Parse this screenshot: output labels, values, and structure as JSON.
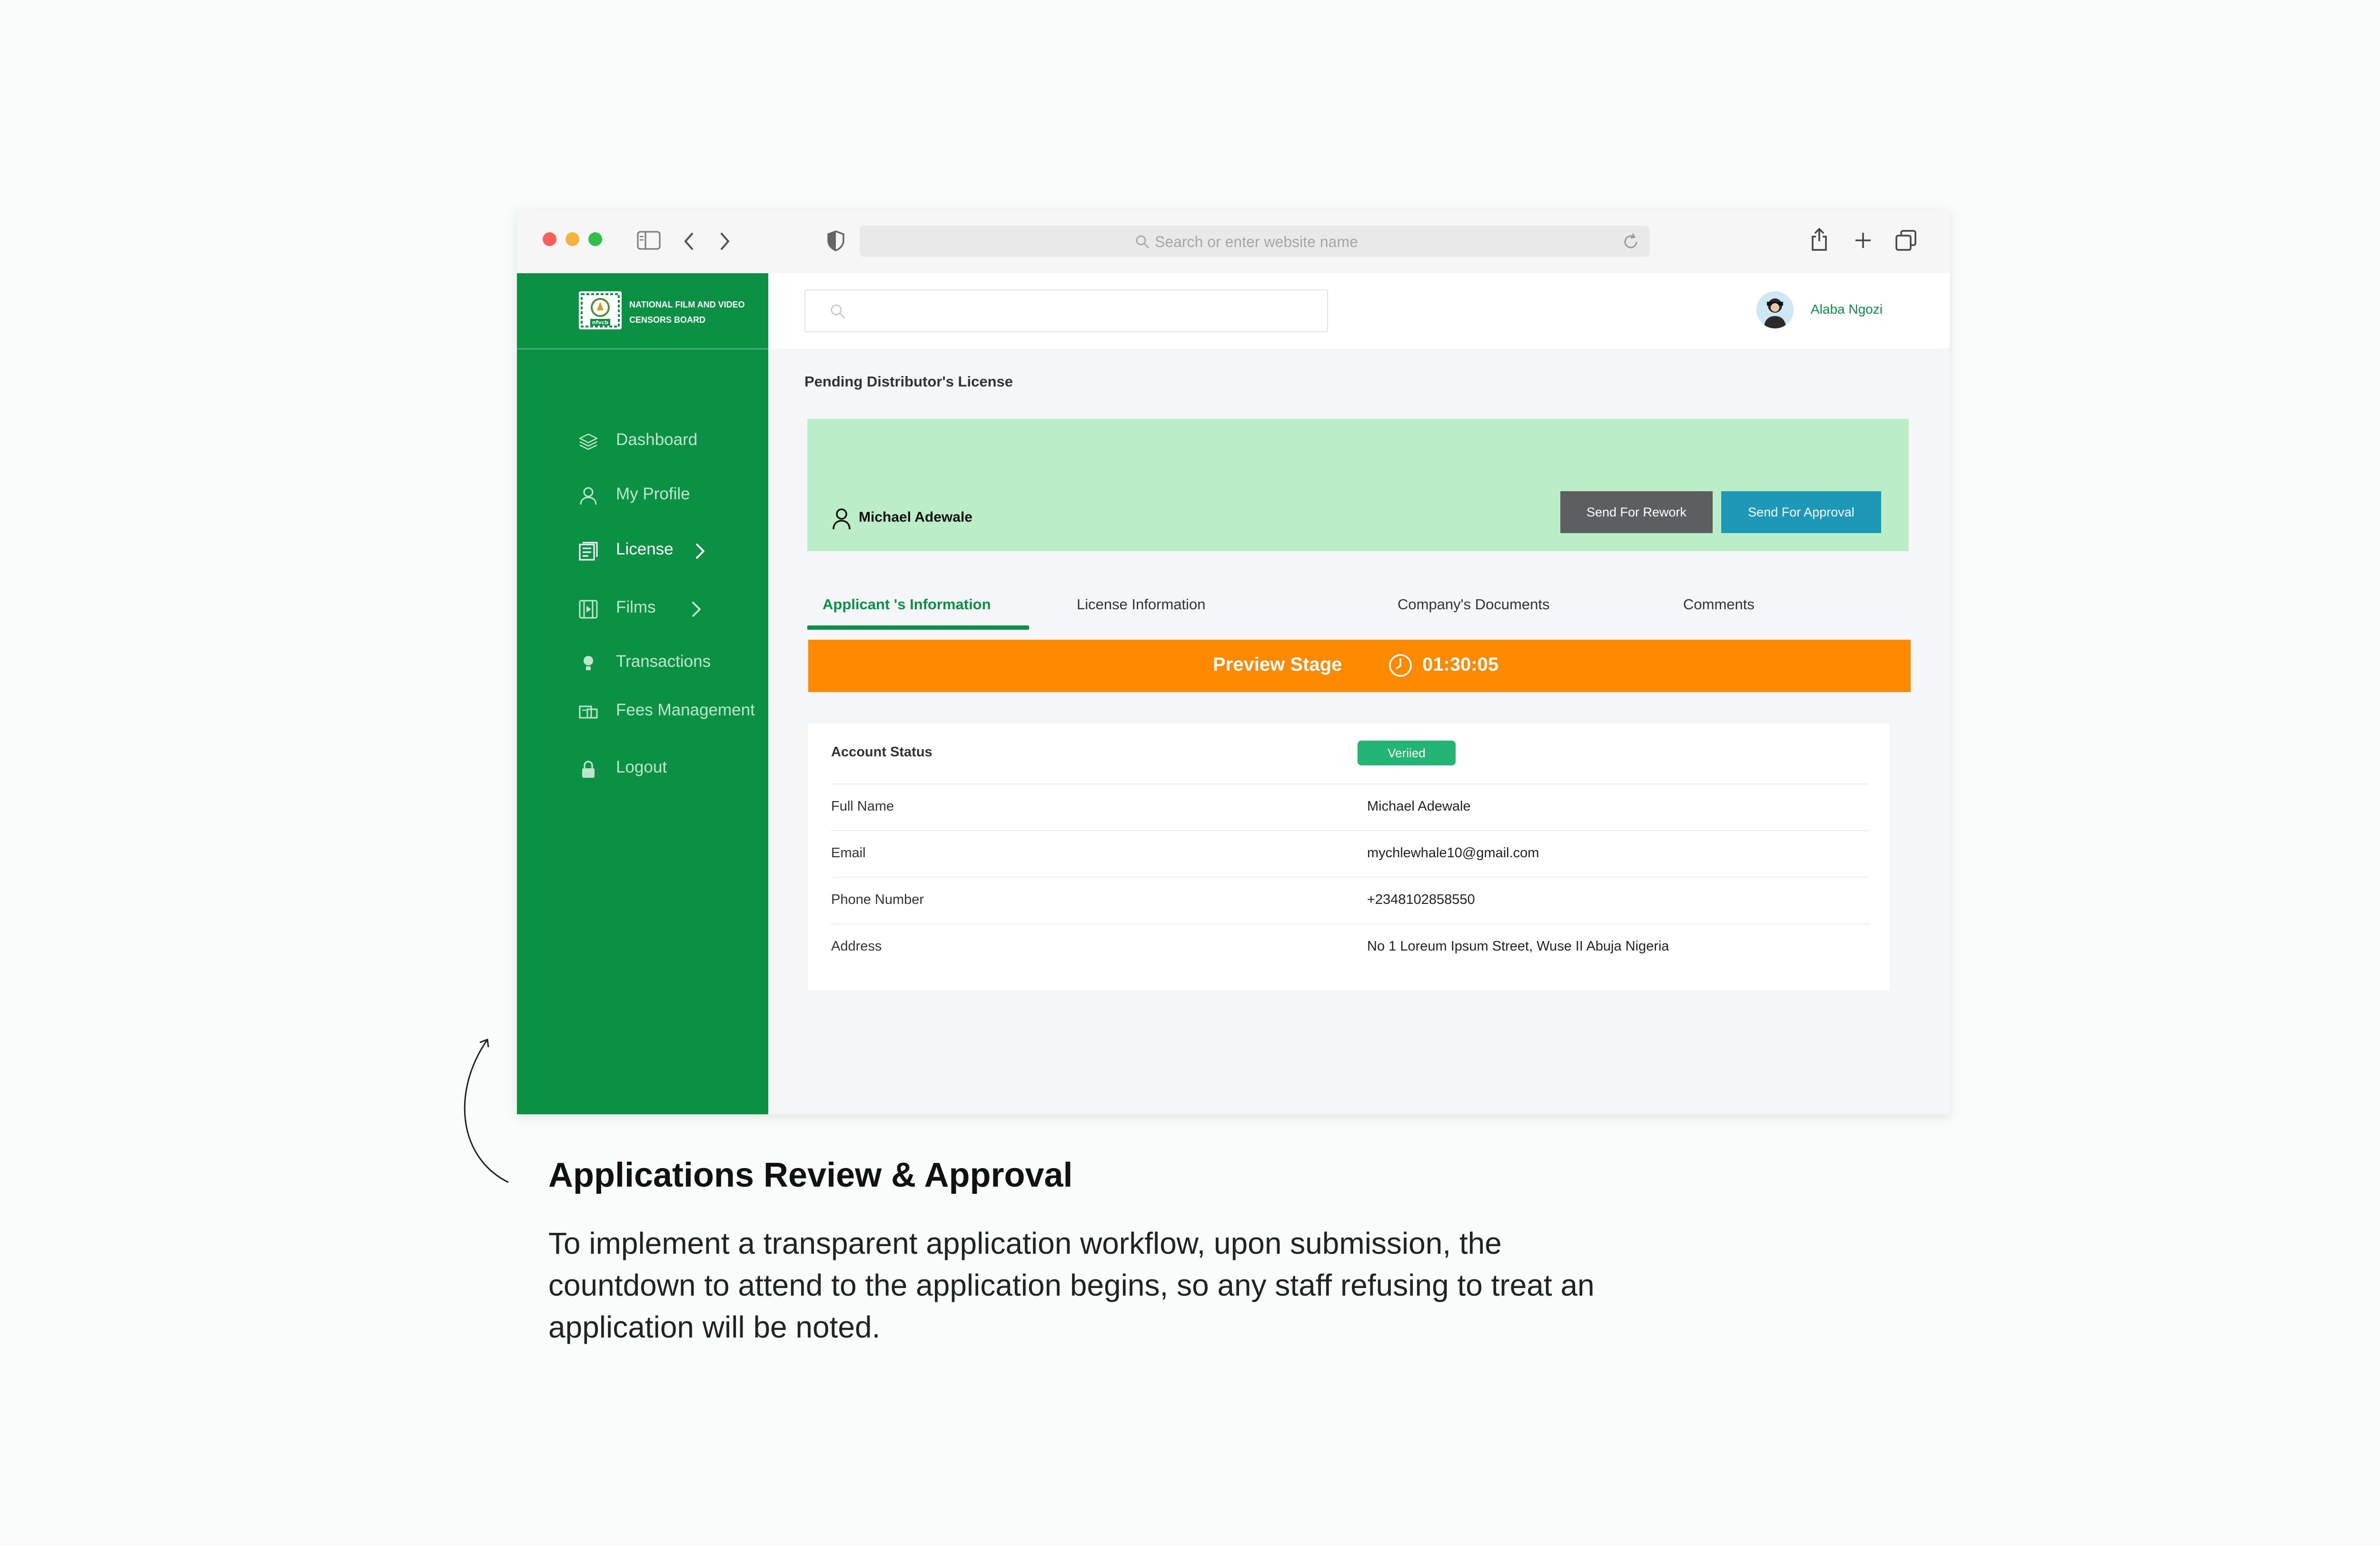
{
  "browser": {
    "url_placeholder": "Search or enter website name",
    "traffic_colors": {
      "close": "#ff5f56",
      "minimize": "#f5b33a",
      "maximize": "#2fc04a"
    }
  },
  "app": {
    "logo_text": "National Film and Video Censors Board",
    "logo_mark": "nfvcb",
    "brand_color": "#0b9144"
  },
  "sidebar": {
    "items": [
      {
        "label": "Dashboard",
        "icon": "layers-icon"
      },
      {
        "label": "My Profile",
        "icon": "user-icon"
      },
      {
        "label": "License",
        "icon": "license-icon",
        "active": true,
        "has_chevron": true
      },
      {
        "label": "Films",
        "icon": "film-icon",
        "has_chevron": true
      },
      {
        "label": "Transactions",
        "icon": "bulb-icon"
      },
      {
        "label": "Fees Management",
        "icon": "fees-icon"
      },
      {
        "label": "Logout",
        "icon": "lock-icon"
      }
    ]
  },
  "header": {
    "search_placeholder": "",
    "user_name": "Alaba Ngozi"
  },
  "page": {
    "title": "Pending Distributor's License",
    "applicant_name": "Michael Adewale",
    "buttons": {
      "rework": "Send For Rework",
      "approve": "Send For Approval"
    },
    "tabs": [
      {
        "label": "Applicant 's Information",
        "active": true
      },
      {
        "label": "License Information"
      },
      {
        "label": "Company's Documents"
      },
      {
        "label": "Comments"
      }
    ],
    "stage": {
      "label": "Preview Stage",
      "timer": "01:30:05",
      "color": "#ff8a00"
    },
    "info": {
      "status_label": "Account Status",
      "status_value": "Veriied",
      "rows": [
        {
          "label": "Full Name",
          "value": "Michael Adewale"
        },
        {
          "label": "Email",
          "value": "mychlewhale10@gmail.com"
        },
        {
          "label": "Phone Number",
          "value": "+2348102858550"
        },
        {
          "label": "Address",
          "value": "No 1 Loreum Ipsum Street, Wuse II Abuja Nigeria"
        }
      ]
    }
  },
  "caption": {
    "title": "Applications  Review & Approval",
    "body": "To implement a transparent application workflow, upon submission, the countdown to attend to the application begins, so any staff refusing to treat an application will be noted."
  }
}
